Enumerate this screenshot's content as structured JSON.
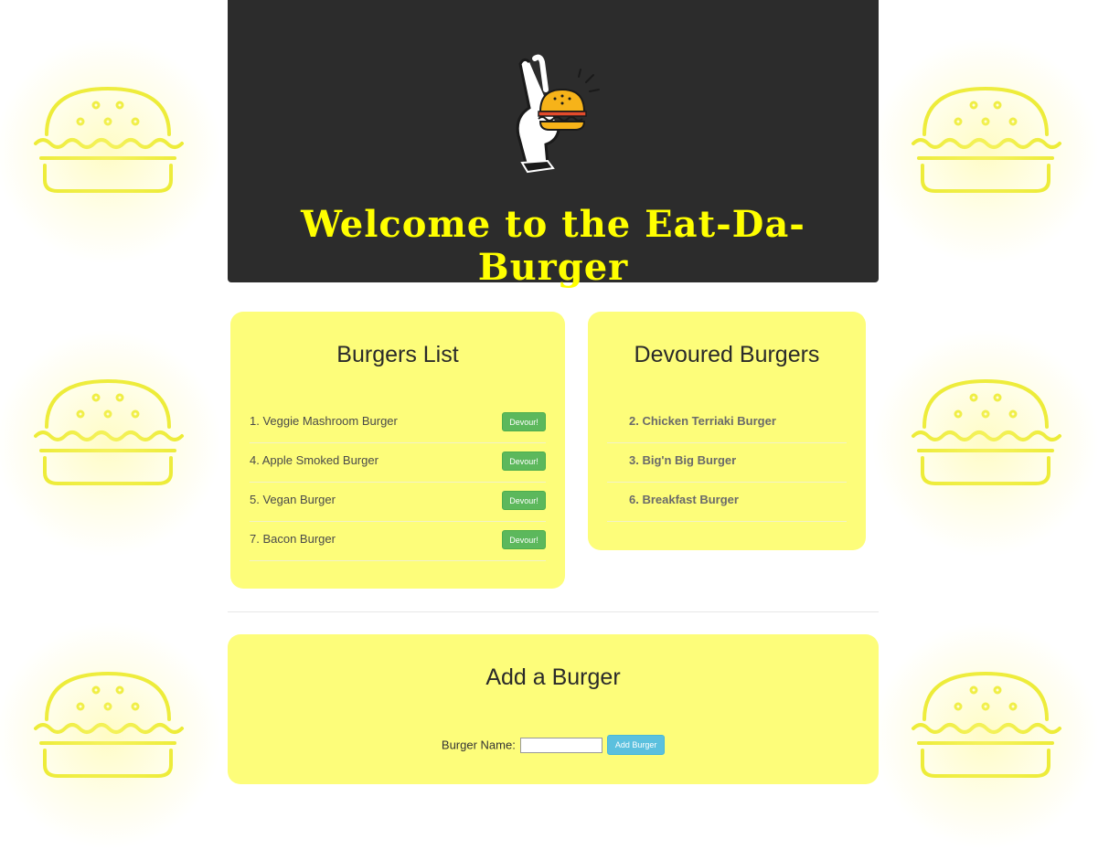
{
  "header": {
    "title": "Welcome to the Eat-Da-Burger"
  },
  "burgers_list": {
    "title": "Burgers List",
    "items": [
      {
        "label": "1. Veggie Mashroom Burger",
        "button": "Devour!"
      },
      {
        "label": "4. Apple Smoked Burger",
        "button": "Devour!"
      },
      {
        "label": "5. Vegan Burger",
        "button": "Devour!"
      },
      {
        "label": "7. Bacon Burger",
        "button": "Devour!"
      }
    ]
  },
  "devoured": {
    "title": "Devoured Burgers",
    "items": [
      {
        "label": "2. Chicken Terriaki Burger"
      },
      {
        "label": "3. Big'n Big Burger"
      },
      {
        "label": "6. Breakfast Burger"
      }
    ]
  },
  "add_form": {
    "title": "Add a Burger",
    "field_label": "Burger Name:",
    "input_value": "",
    "button": "Add Burger"
  },
  "colors": {
    "accent_yellow": "#ffff00",
    "panel_bg": "#fdfd7a",
    "devour_green": "#5cb85c",
    "add_blue": "#5bc0de"
  },
  "icons": {
    "logo": "ok-hand-burger-logo",
    "decor": "neon-burger-icon"
  }
}
